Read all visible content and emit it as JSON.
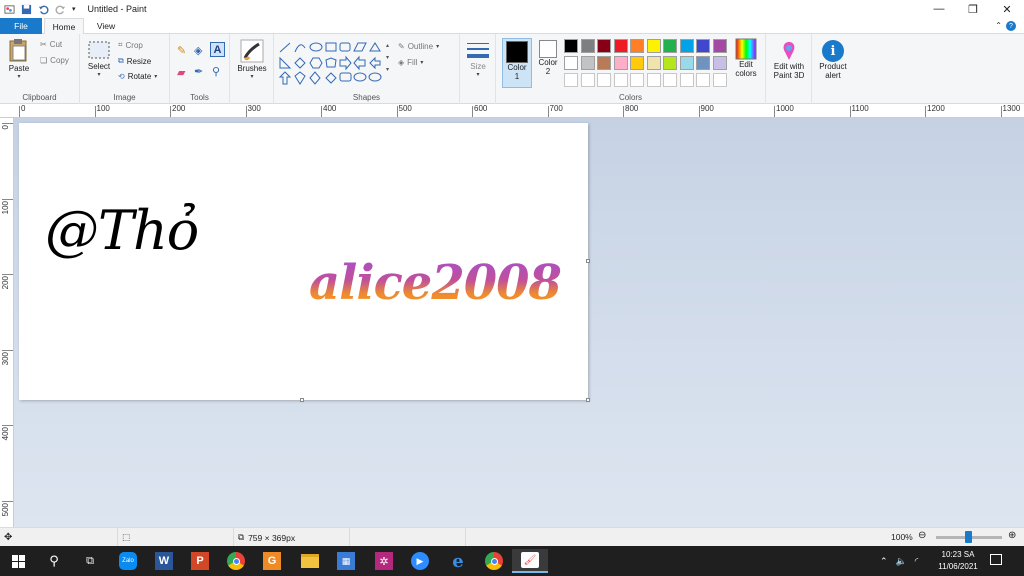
{
  "window": {
    "title": "Untitled - Paint",
    "controls": [
      "minimize",
      "restore",
      "close"
    ]
  },
  "tabs": [
    {
      "label": "File",
      "active": false
    },
    {
      "label": "Home",
      "active": true
    },
    {
      "label": "View",
      "active": false
    }
  ],
  "ribbon": {
    "clipboard": {
      "label": "Clipboard",
      "paste": "Paste",
      "cut": "Cut",
      "copy": "Copy"
    },
    "image": {
      "label": "Image",
      "select": "Select",
      "crop": "Crop",
      "resize": "Resize",
      "rotate": "Rotate"
    },
    "tools": {
      "label": "Tools"
    },
    "brushes": {
      "label": "Brushes"
    },
    "shapes": {
      "label": "Shapes",
      "outline": "Outline",
      "fill": "Fill"
    },
    "size": {
      "label": "Size"
    },
    "colors": {
      "label": "Colors",
      "color1": "Color 1",
      "color2": "Color 2",
      "color1_value": "#000000",
      "color2_value": "#ffffff",
      "edit_colors": "Edit colors",
      "palette": [
        "#000000",
        "#7f7f7f",
        "#880015",
        "#ed1c24",
        "#ff7f27",
        "#fff200",
        "#22b14c",
        "#00a2e8",
        "#3f48cc",
        "#a349a4",
        "#ffffff",
        "#c3c3c3",
        "#b97a57",
        "#ffaec9",
        "#ffc90e",
        "#efe4b0",
        "#b5e61d",
        "#99d9ea",
        "#7092be",
        "#c8bfe7"
      ]
    },
    "paint3d": "Edit with Paint 3D",
    "product_alert": "Product alert"
  },
  "ruler": {
    "h_labels": [
      "0",
      "100",
      "200",
      "300",
      "400",
      "500",
      "600",
      "700",
      "800",
      "900",
      "1000",
      "1100",
      "1200",
      "1300"
    ],
    "v_labels": [
      "0",
      "100",
      "200",
      "300",
      "400",
      "500"
    ]
  },
  "canvas": {
    "text1": "@Thỏ",
    "text2": "alice2008"
  },
  "statusbar": {
    "canvas_size": "759 × 369px",
    "zoom": "100%",
    "zoom_level_percent": 100
  },
  "taskbar": {
    "apps": [
      "start",
      "search",
      "task-view",
      "zalo",
      "word",
      "powerpoint",
      "chrome",
      "explorer",
      "foxit",
      "calculator",
      "photos",
      "zoom",
      "edge",
      "chrome-2",
      "paint"
    ],
    "time": "10:23 SA",
    "date": "11/06/2021"
  }
}
